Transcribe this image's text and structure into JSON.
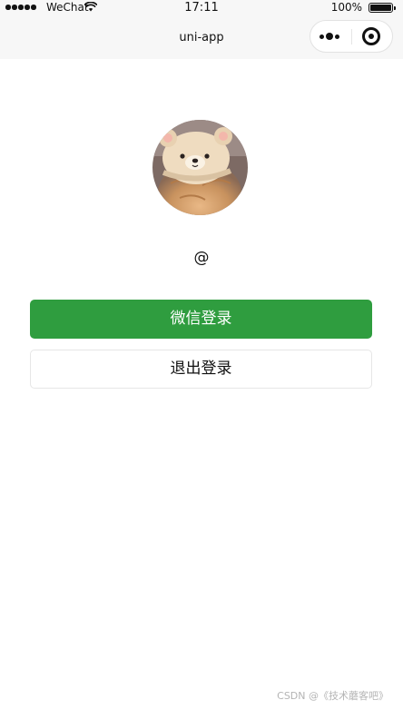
{
  "status_bar": {
    "carrier": "WeChat",
    "time": "17:11",
    "battery": "100%"
  },
  "nav": {
    "title": "uni-app"
  },
  "profile": {
    "nickname": "@"
  },
  "buttons": {
    "wechat_login": "微信登录",
    "logout": "退出登录"
  },
  "watermark": "CSDN @《技术蘑客吧》",
  "colors": {
    "primary_green": "#2f9d3f",
    "bar_background": "#f7f7f7",
    "page_background": "#ffffff"
  }
}
